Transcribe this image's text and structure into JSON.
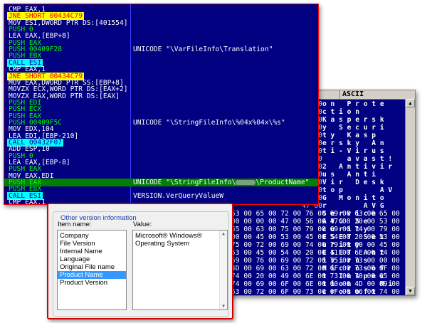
{
  "disasm_rows": [
    {
      "ins": "CMP EAX,1",
      "kind": "normal",
      "comment": ""
    },
    {
      "ins": "JNE SHORT 00434C79",
      "kind": "jmp",
      "comment": ""
    },
    {
      "ins": "MOV ESI,DWORD PTR DS:[401554]",
      "kind": "normal",
      "comment": ""
    },
    {
      "ins": "PUSH 0",
      "kind": "push",
      "comment": ""
    },
    {
      "ins": "LEA EAX,[EBP+8]",
      "kind": "normal",
      "comment": ""
    },
    {
      "ins": "PUSH EAX",
      "kind": "push",
      "comment": ""
    },
    {
      "ins": "PUSH 00409F28",
      "kind": "push",
      "comment": "UNICODE \"\\VarFileInfo\\Translation\""
    },
    {
      "ins": "PUSH EBX",
      "kind": "push",
      "comment": ""
    },
    {
      "ins": "CALL ESI",
      "kind": "call",
      "comment": ""
    },
    {
      "ins": "CMP EAX,1",
      "kind": "normal",
      "comment": ""
    },
    {
      "ins": "JNE SHORT 00434C79",
      "kind": "jmp",
      "comment": ""
    },
    {
      "ins": "MOV EAX,DWORD PTR SS:[EBP+8]",
      "kind": "normal",
      "comment": ""
    },
    {
      "ins": "MOVZX ECX,WORD PTR DS:[EAX+2]",
      "kind": "normal",
      "comment": ""
    },
    {
      "ins": "MOVZX EAX,WORD PTR DS:[EAX]",
      "kind": "normal",
      "comment": ""
    },
    {
      "ins": "PUSH EDI",
      "kind": "push",
      "comment": ""
    },
    {
      "ins": "PUSH ECX",
      "kind": "push",
      "comment": ""
    },
    {
      "ins": "PUSH EAX",
      "kind": "push",
      "comment": ""
    },
    {
      "ins": "PUSH 00409F5C",
      "kind": "push",
      "comment": "UNICODE \"\\StringFileInfo\\%04x%04x\\%s\""
    },
    {
      "ins": "MOV EDX,104",
      "kind": "normal",
      "comment": ""
    },
    {
      "ins": "LEA EDI,[EBP-210]",
      "kind": "normal",
      "comment": ""
    },
    {
      "ins": "CALL 00432F07",
      "kind": "call",
      "comment": ""
    },
    {
      "ins": "ADD ESP,10",
      "kind": "normal",
      "comment": ""
    },
    {
      "ins": "PUSH 0",
      "kind": "push",
      "comment": ""
    },
    {
      "ins": "LEA EAX,[EBP-8]",
      "kind": "normal",
      "comment": ""
    },
    {
      "ins": "PUSH EAX",
      "kind": "push",
      "comment": ""
    },
    {
      "ins": "MOV EAX,EDI",
      "kind": "normal",
      "comment": ""
    },
    {
      "ins": "PUSH EAX",
      "kind": "hl",
      "comment": "UNICODE \"\\StringFileInfo\\",
      "comment_tail": "\\ProductName\""
    },
    {
      "ins": "PUSH EBX",
      "kind": "push",
      "comment": ""
    },
    {
      "ins": "CALL ESI",
      "kind": "call",
      "comment": "VERSION.VerQueryValueW"
    },
    {
      "ins": "CMP EAX,1",
      "kind": "normal",
      "comment": ""
    }
  ],
  "hex_header": "ASCII",
  "hex_rows": [
    {
      "hex": "65 00",
      "ascii": "o n   P r o t e"
    },
    {
      "hex": "6E 00",
      "ascii": "c t i o n"
    },
    {
      "hex": "6B 00",
      "ascii": "K a s p e r s k"
    },
    {
      "hex": "69 00",
      "ascii": "y   S e c u r i"
    },
    {
      "hex": "70 00",
      "ascii": "t y   K a s p"
    },
    {
      "hex": "72 00",
      "ascii": "e r s k y   A n"
    },
    {
      "hex": "73 00",
      "ascii": "t i - V i r u s"
    },
    {
      "hex": "21 00",
      "ascii": "      a v a s t !"
    },
    {
      "hex": "6E 00",
      "ascii": "2   A n t i v i r"
    },
    {
      "hex": "69 00",
      "ascii": "u s   A n t i"
    },
    {
      "hex": "73 00",
      "ascii": "V i r   D e s k"
    },
    {
      "hex": "56 00",
      "ascii": "t o p         A V"
    },
    {
      "hex": "6F 00",
      "ascii": "G   M o n i t o"
    },
    {
      "hex": "47 00",
      "ascii": "r         A V G"
    },
    {
      "hex": "53 00 65 00 72 00 76 00 69 00 63 00 65 00",
      "ascii": "S e r v i c e"
    },
    {
      "hex": "00 00 00 00 47 00 56 00 47 00 20 00 53 00",
      "ascii": "A V G   S e"
    },
    {
      "hex": "65 00 63 00 75 00 79 00 69 00 74 00 79 00",
      "ascii": "c u r i t y"
    },
    {
      "hex": "00 00 45 00 53 00 45 00 54 00 20 00 53 00",
      "ascii": "E S E T   S e c"
    },
    {
      "hex": "75 00 72 00 69 00 74 00 79 00 00 00 45 00",
      "ascii": "u r i t y"
    },
    {
      "hex": "53 00 45 00 54 00 20 00 41 00 6E 00 74 00",
      "ascii": "E S E T   A n t"
    },
    {
      "hex": "69 00 76 00 69 00 72 00 75 00 73 00 00 00",
      "ascii": "i v i r u s"
    },
    {
      "hex": "4D 00 69 00 63 00 72 00 6F 00 73 00 6F 00",
      "ascii": "M i c r o s o f"
    },
    {
      "hex": "74 00 20 00 49 00 6E 00 73 00 70 00 65 00",
      "ascii": "t   I n s p e c"
    },
    {
      "hex": "74 00 69 00 6F 00 6E 00 00 00 4D 00 69 00",
      "ascii": "t i o n       M i"
    },
    {
      "hex": "63 00 72 00 6F 00 73 00 6F 00 66 00 74 00",
      "ascii": "c r o s o f t"
    },
    {
      "hex": "4D 00 61 00 6C 00 77 00 61 00 72 00 65 00",
      "ascii": "M a l w a r e"
    },
    {
      "hex": "00 00 4D 00 69 00 63 00 72 00 6F 00 73 00",
      "ascii": "    M i c r o s"
    }
  ],
  "dialog": {
    "group_title": "Other version information",
    "item_label": "Item name:",
    "value_label": "Value:",
    "items": [
      "Company",
      "File Version",
      "Internal Name",
      "Language",
      "Original File name",
      "Product Name",
      "Product Version"
    ],
    "selected_index": 5,
    "value_lines": [
      "Microsoft® Windows®",
      "Operating System"
    ]
  },
  "colors": {
    "bg_navy": "#000080",
    "push_green": "#00ff00",
    "jump_yellow": "#ffff00",
    "call_cyan": "#00ffff",
    "highlight_green": "#008000",
    "selection_blue": "#3399ff",
    "frame_red": "#d00000"
  }
}
